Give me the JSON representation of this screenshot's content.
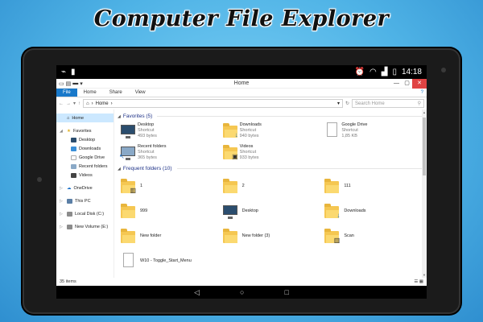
{
  "promo": {
    "title": "Computer File Explorer"
  },
  "statusbar": {
    "time": "14:18"
  },
  "window": {
    "title": "Home",
    "ribbon_tabs": [
      "File",
      "Home",
      "Share",
      "View"
    ],
    "address": "Home",
    "search_placeholder": "Search Home"
  },
  "nav": {
    "home": "Home",
    "favorites": "Favorites",
    "fav_items": [
      "Desktop",
      "Downloads",
      "Google Drive",
      "Recent folders",
      "Videos"
    ],
    "onedrive": "OneDrive",
    "this_pc": "This PC",
    "local_disk": "Local Disk (C:)",
    "new_volume": "New Volume (E:)"
  },
  "favorites_group": {
    "header": "Favorites (5)",
    "items": [
      {
        "name": "Desktop",
        "type": "Shortcut",
        "size": "493 bytes",
        "icon": "desktop-icon"
      },
      {
        "name": "Downloads",
        "type": "Shortcut",
        "size": "940 bytes",
        "icon": "downloads-folder-icon"
      },
      {
        "name": "Google Drive",
        "type": "Shortcut",
        "size": "1,85 KB",
        "icon": "document-icon"
      },
      {
        "name": "Recent folders",
        "type": "Shortcut",
        "size": "365 bytes",
        "icon": "recent-folders-icon"
      },
      {
        "name": "Videos",
        "type": "Shortcut",
        "size": "933 bytes",
        "icon": "videos-icon"
      }
    ]
  },
  "frequent_group": {
    "header": "Frequent folders (10)",
    "items": [
      "1",
      "2",
      "111",
      "999",
      "Desktop",
      "Downloads",
      "New folder",
      "New folder (3)",
      "Scan",
      "W10 - Toggle_Start_Menu"
    ]
  },
  "status": {
    "items_count": "35 items"
  },
  "colors": {
    "accent": "#1979ca",
    "close": "#e04343",
    "folder": "#f5c752"
  }
}
